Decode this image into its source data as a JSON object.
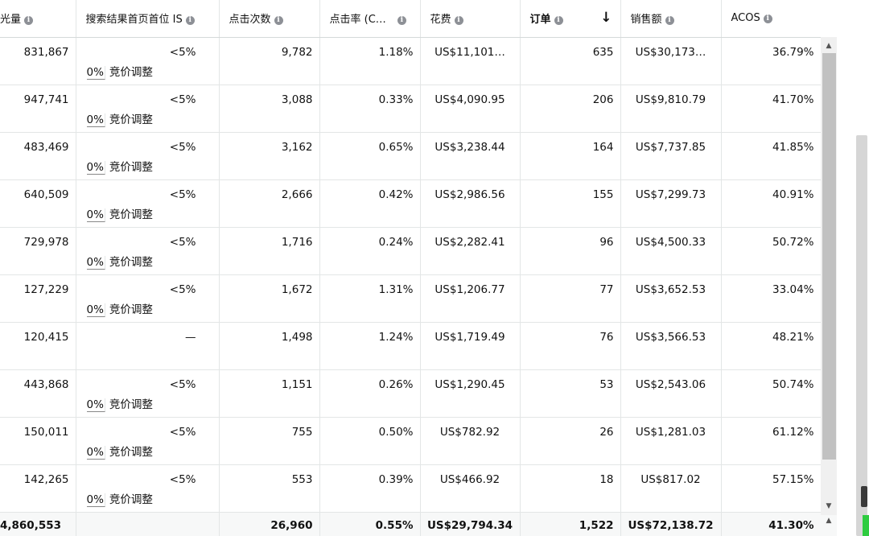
{
  "columns": [
    {
      "label": "光量"
    },
    {
      "label": "搜索结果首页首位 IS"
    },
    {
      "label": "点击次数"
    },
    {
      "label": "点击率 (C…"
    },
    {
      "label": "花费"
    },
    {
      "label": "订单"
    },
    {
      "label": "销售额"
    },
    {
      "label": "ACOS"
    }
  ],
  "bid_adjust": {
    "pct": "0%",
    "label": "竞价调整"
  },
  "rows": [
    {
      "impressions": "831,867",
      "is": "<5%",
      "clicks": "9,782",
      "ctr": "1.18%",
      "spend": "US$11,101…",
      "orders": "635",
      "sales": "US$30,173…",
      "acos": "36.79%"
    },
    {
      "impressions": "947,741",
      "is": "<5%",
      "clicks": "3,088",
      "ctr": "0.33%",
      "spend": "US$4,090.95",
      "orders": "206",
      "sales": "US$9,810.79",
      "acos": "41.70%"
    },
    {
      "impressions": "483,469",
      "is": "<5%",
      "clicks": "3,162",
      "ctr": "0.65%",
      "spend": "US$3,238.44",
      "orders": "164",
      "sales": "US$7,737.85",
      "acos": "41.85%"
    },
    {
      "impressions": "640,509",
      "is": "<5%",
      "clicks": "2,666",
      "ctr": "0.42%",
      "spend": "US$2,986.56",
      "orders": "155",
      "sales": "US$7,299.73",
      "acos": "40.91%"
    },
    {
      "impressions": "729,978",
      "is": "<5%",
      "clicks": "1,716",
      "ctr": "0.24%",
      "spend": "US$2,282.41",
      "orders": "96",
      "sales": "US$4,500.33",
      "acos": "50.72%"
    },
    {
      "impressions": "127,229",
      "is": "<5%",
      "clicks": "1,672",
      "ctr": "1.31%",
      "spend": "US$1,206.77",
      "orders": "77",
      "sales": "US$3,652.53",
      "acos": "33.04%"
    },
    {
      "impressions": "120,415",
      "is": "—",
      "clicks": "1,498",
      "ctr": "1.24%",
      "spend": "US$1,719.49",
      "orders": "76",
      "sales": "US$3,566.53",
      "acos": "48.21%"
    },
    {
      "impressions": "443,868",
      "is": "<5%",
      "clicks": "1,151",
      "ctr": "0.26%",
      "spend": "US$1,290.45",
      "orders": "53",
      "sales": "US$2,543.06",
      "acos": "50.74%"
    },
    {
      "impressions": "150,011",
      "is": "<5%",
      "clicks": "755",
      "ctr": "0.50%",
      "spend": "US$782.92",
      "orders": "26",
      "sales": "US$1,281.03",
      "acos": "61.12%"
    },
    {
      "impressions": "142,265",
      "is": "<5%",
      "clicks": "553",
      "ctr": "0.39%",
      "spend": "US$466.92",
      "orders": "18",
      "sales": "US$817.02",
      "acos": "57.15%"
    }
  ],
  "totals": {
    "impressions": "4,860,553",
    "clicks": "26,960",
    "ctr": "0.55%",
    "spend": "US$29,794.34",
    "orders": "1,522",
    "sales": "US$72,138.72",
    "acos": "41.30%"
  }
}
